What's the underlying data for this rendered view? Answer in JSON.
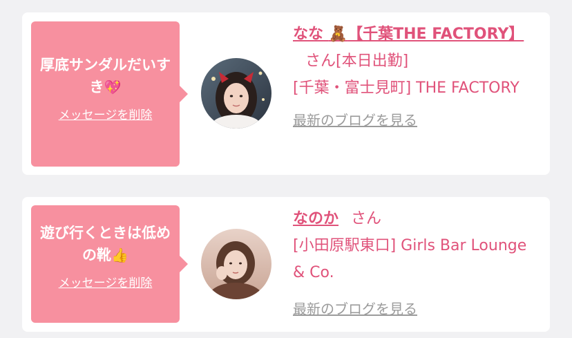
{
  "cards": [
    {
      "message": "厚底サンダルだいすき",
      "message_emoji": "💖",
      "delete_label": "メッセージを削除",
      "name_emoji": "🧸",
      "name": "なな",
      "name_store": "【千葉THE FACTORY】",
      "honorific": "さん",
      "status": "[本日出勤]",
      "store_line": "[千葉・富士見町] THE FACTORY",
      "blog_label": "最新のブログを見る"
    },
    {
      "message": "遊び行くときは低めの靴",
      "message_emoji": "👍",
      "delete_label": "メッセージを削除",
      "name": "なのか",
      "honorific": "さん",
      "store_line": "[小田原駅東口] Girls Bar Lounge & Co.",
      "blog_label": "最新のブログを見る"
    }
  ]
}
